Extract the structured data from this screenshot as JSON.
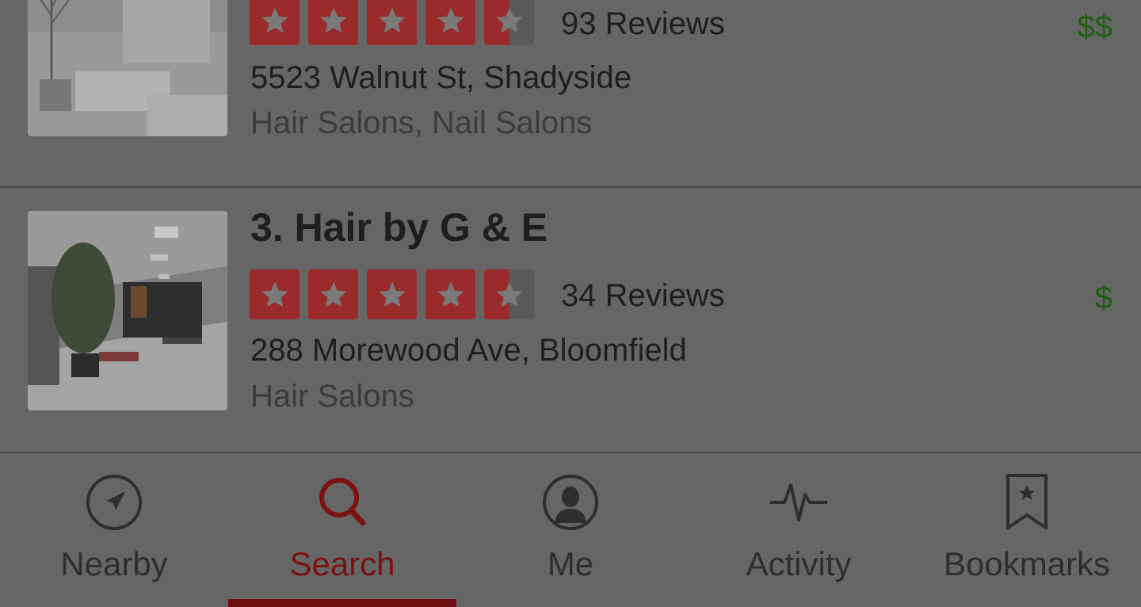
{
  "listings": [
    {
      "title": "",
      "rating": 4.5,
      "reviews": "93 Reviews",
      "price": "$$",
      "address": "5523 Walnut St, Shadyside",
      "categories": "Hair Salons, Nail Salons"
    },
    {
      "title": "3. Hair by G & E",
      "rating": 4.5,
      "reviews": "34 Reviews",
      "price": "$",
      "address": "288 Morewood Ave, Bloomfield",
      "categories": "Hair Salons"
    }
  ],
  "tabs": [
    {
      "label": "Nearby",
      "icon": "compass-icon",
      "active": false
    },
    {
      "label": "Search",
      "icon": "search-icon",
      "active": true
    },
    {
      "label": "Me",
      "icon": "profile-icon",
      "active": false
    },
    {
      "label": "Activity",
      "icon": "activity-icon",
      "active": false
    },
    {
      "label": "Bookmarks",
      "icon": "bookmark-icon",
      "active": false
    }
  ],
  "colors": {
    "overlay_bg": "#666666",
    "star_red": "#9b2a2a",
    "price_green": "#1f5f12",
    "active_tab": "#7a1212"
  }
}
